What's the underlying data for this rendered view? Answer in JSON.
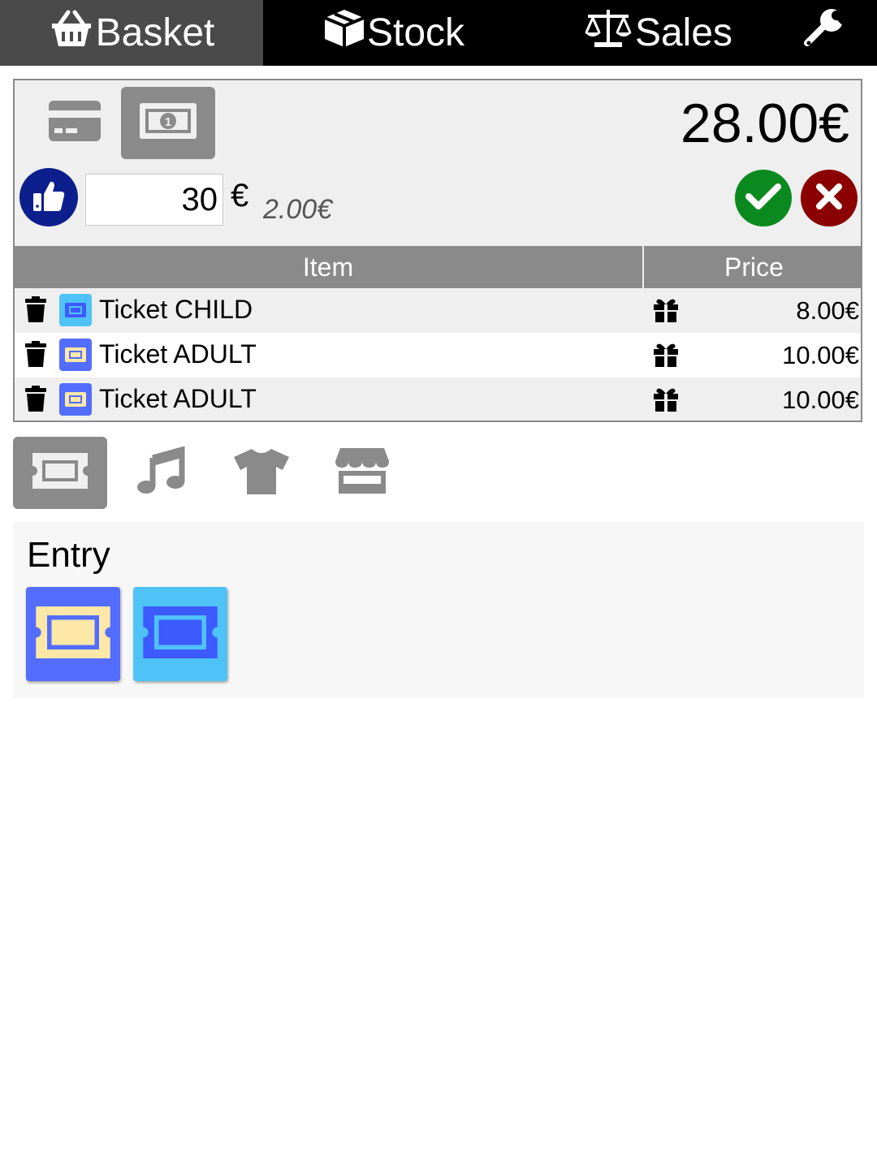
{
  "nav": {
    "tabs": [
      {
        "label": "Basket",
        "icon": "basket-icon"
      },
      {
        "label": "Stock",
        "icon": "box-icon"
      },
      {
        "label": "Sales",
        "icon": "scale-icon"
      }
    ],
    "settings_icon": "wrench-icon",
    "active": "Basket"
  },
  "payment": {
    "methods": [
      {
        "name": "card",
        "icon": "credit-card-icon"
      },
      {
        "name": "cash",
        "icon": "cash-icon"
      }
    ],
    "selected": "cash",
    "total": "28.00€",
    "tendered_value": "30",
    "currency": "€",
    "change": "2.00€"
  },
  "basket": {
    "headers": {
      "item": "Item",
      "price": "Price"
    },
    "rows": [
      {
        "name": "Ticket CHILD",
        "price": "8.00€",
        "ticket_bg": "#4fc3f7",
        "ticket_fg": "#3d5afe"
      },
      {
        "name": "Ticket ADULT",
        "price": "10.00€",
        "ticket_bg": "#536dfe",
        "ticket_fg": "#fde8a8"
      },
      {
        "name": "Ticket ADULT",
        "price": "10.00€",
        "ticket_bg": "#536dfe",
        "ticket_fg": "#fde8a8"
      }
    ]
  },
  "categories": [
    {
      "icon": "ticket-icon"
    },
    {
      "icon": "music-icon"
    },
    {
      "icon": "tshirt-icon"
    },
    {
      "icon": "store-icon"
    }
  ],
  "selected_category": "ticket-icon",
  "section": {
    "title": "Entry",
    "products": [
      {
        "name": "ticket-adult",
        "bg": "#536dfe",
        "fg": "#fde8a8"
      },
      {
        "name": "ticket-child",
        "bg": "#4fc3f7",
        "fg": "#3d5afe"
      }
    ]
  },
  "colors": {
    "accept": "#0a8a1e",
    "cancel": "#8b0000",
    "thumb": "#0c1f8c",
    "header_gray": "#8a8a8a"
  }
}
